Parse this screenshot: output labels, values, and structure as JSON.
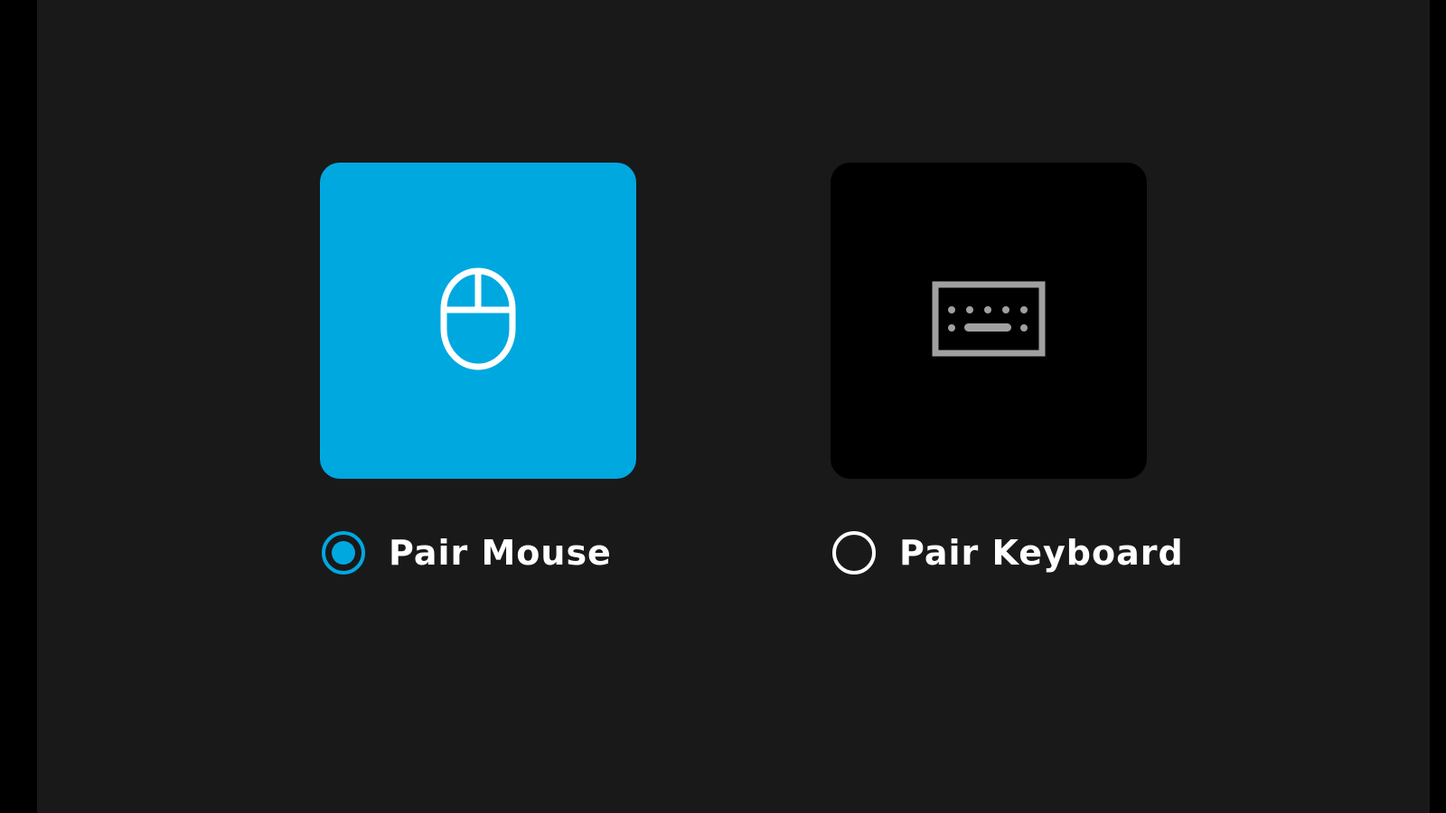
{
  "colors": {
    "accent": "#00a8e0",
    "background": "#191919",
    "tile_unselected": "#000000",
    "text": "#ffffff",
    "keyboard_icon": "#a0a0a0"
  },
  "options": [
    {
      "id": "mouse",
      "label": "Pair Mouse",
      "icon": "mouse-icon",
      "selected": true
    },
    {
      "id": "keyboard",
      "label": "Pair Keyboard",
      "icon": "keyboard-icon",
      "selected": false
    }
  ]
}
